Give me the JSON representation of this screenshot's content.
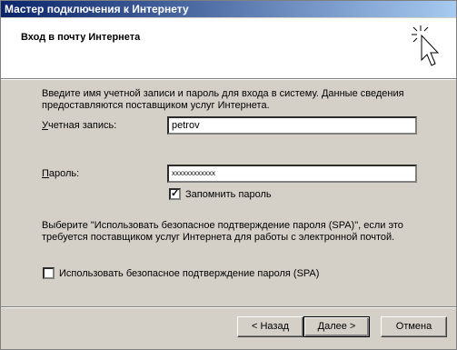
{
  "window": {
    "title": "Мастер подключения к Интернету"
  },
  "header": {
    "title": "Вход в почту Интернета",
    "icon": "sparkle-cursor-icon"
  },
  "form": {
    "intro": "Введите имя учетной записи и пароль для входа в систему. Данные сведения предоставляются поставщиком услуг Интернета.",
    "account_label": "Учетная запись:",
    "account_value": "petrov",
    "password_label": "Пароль:",
    "password_value": "xxxxxxxxxxxx",
    "remember_label": "Запомнить пароль",
    "remember_checked": true,
    "spa_note": "Выберите \"Использовать безопасное подтверждение пароля (SPA)\", если это требуется поставщиком услуг Интернета для работы с электронной почтой.",
    "spa_label": "Использовать безопасное подтверждение пароля (SPA)",
    "spa_checked": false
  },
  "buttons": {
    "back": "< Назад",
    "next": "Далее >",
    "cancel": "Отмена"
  }
}
